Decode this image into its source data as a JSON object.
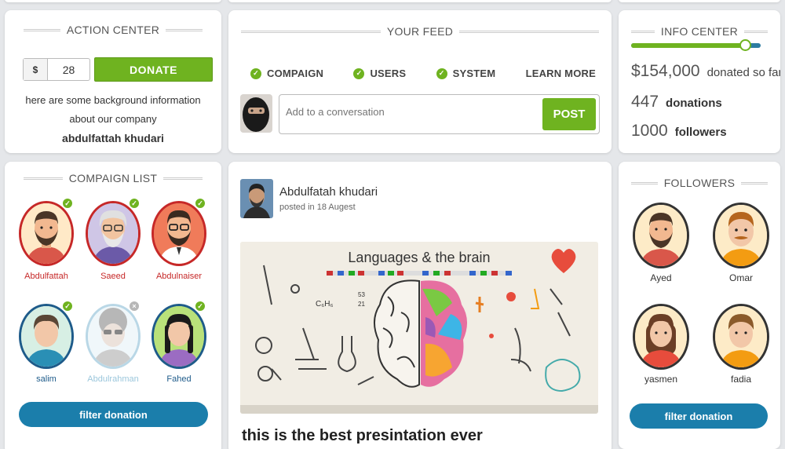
{
  "action_center": {
    "title": "ACTION CENTER",
    "currency": "$",
    "amount": "28",
    "donate_label": "DONATE",
    "info_line1": "here are some background information",
    "info_line2": "about our company",
    "company_name": "abdulfattah khudari"
  },
  "feed": {
    "title": "YOUR FEED",
    "tabs": [
      {
        "label": "COMPAIGN",
        "checked": true
      },
      {
        "label": "USERS",
        "checked": true
      },
      {
        "label": "SYSTEM",
        "checked": true
      },
      {
        "label": "LEARN MORE",
        "checked": false
      }
    ],
    "placeholder": "Add to a conversation",
    "post_label": "POST"
  },
  "info_center": {
    "title": "INFO CENTER",
    "progress": 0.88,
    "donated_amount": "$154,000",
    "donated_label": "donated so far",
    "donations_count": "447",
    "donations_label": "donations",
    "followers_count": "1000",
    "followers_label": "followers"
  },
  "campaign_list": {
    "title": "COMPAIGN LIST",
    "people": [
      {
        "name": "Abdulfattah",
        "status": "checked"
      },
      {
        "name": "Saeed",
        "status": "checked"
      },
      {
        "name": "Abdulnaiser",
        "status": "checked"
      },
      {
        "name": "salim",
        "status": "checked"
      },
      {
        "name": "Abdulrahman",
        "status": "removed"
      },
      {
        "name": "Fahed",
        "status": "checked"
      }
    ],
    "filter_label": "filter donation"
  },
  "post": {
    "author": "Abdulfatah khudari",
    "date": "posted in 18 Augest",
    "image_title": "Languages & the brain",
    "caption": "this is the best presintation ever"
  },
  "followers": {
    "title": "FOLLOWERS",
    "people": [
      {
        "name": "Ayed"
      },
      {
        "name": "Omar"
      },
      {
        "name": "yasmen"
      },
      {
        "name": "fadia"
      }
    ],
    "filter_label": "filter donation"
  },
  "colors": {
    "accent_green": "#6fb320",
    "accent_blue": "#1b7eab",
    "alert_red": "#c62828"
  }
}
